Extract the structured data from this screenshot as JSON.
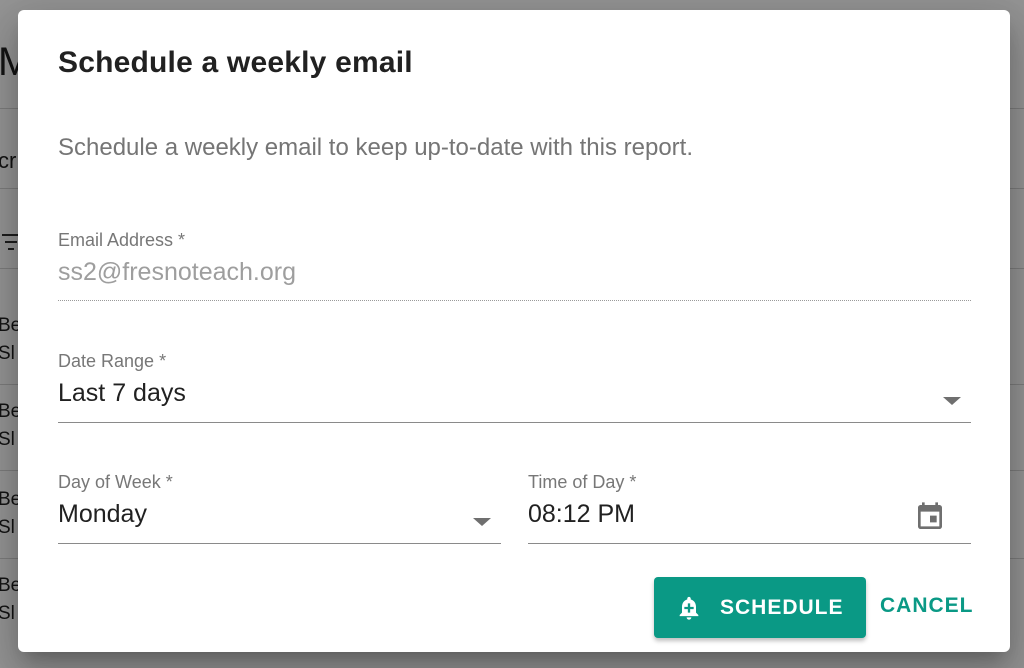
{
  "background": {
    "page_title_partial": "M",
    "tab_partial": "cr",
    "row_partials": [
      {
        "line1": "Be",
        "line2": "Sl"
      },
      {
        "line1": "Be",
        "line2": "Sl"
      },
      {
        "line1": "Be",
        "line2": "Sl"
      },
      {
        "line1": "Be",
        "line2": "Sl"
      }
    ]
  },
  "dialog": {
    "title": "Schedule a weekly email",
    "description": "Schedule a weekly email to keep up-to-date with this report.",
    "email": {
      "label": "Email Address *",
      "value": "ss2@fresnoteach.org"
    },
    "date_range": {
      "label": "Date Range *",
      "value": "Last 7 days"
    },
    "day_of_week": {
      "label": "Day of Week *",
      "value": "Monday"
    },
    "time_of_day": {
      "label": "Time of Day *",
      "value": "08:12 PM"
    },
    "actions": {
      "schedule_label": "SCHEDULE",
      "cancel_label": "CANCEL"
    }
  },
  "icons": {
    "schedule_icon": "bell-plus-icon",
    "time_picker_icon": "calendar-icon",
    "dropdown_icon": "chevron-down-icon"
  },
  "colors": {
    "accent": "#0a9985",
    "title_text": "#212121",
    "muted_text": "#757575"
  }
}
